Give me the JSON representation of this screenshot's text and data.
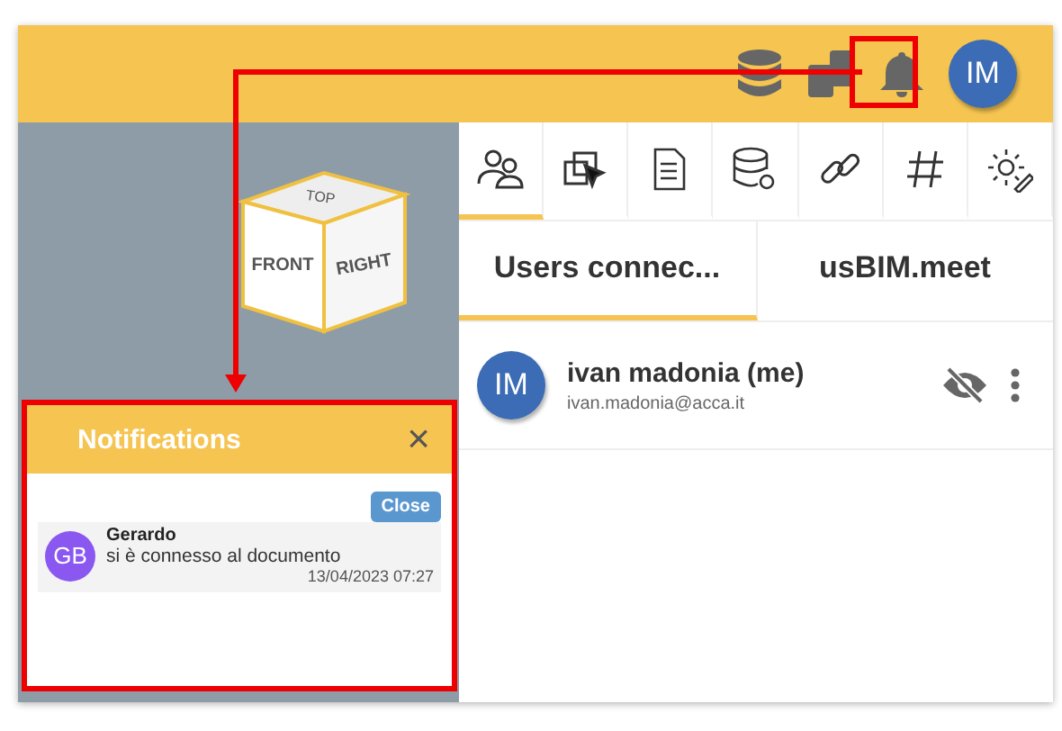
{
  "header": {
    "avatar": "IM"
  },
  "cube": {
    "top": "TOP",
    "front": "FRONT",
    "right": "RIGHT"
  },
  "tool_tabs": [
    {
      "selected": true
    },
    {
      "selected": false
    },
    {
      "selected": false
    },
    {
      "selected": false
    },
    {
      "selected": false
    },
    {
      "selected": false
    },
    {
      "selected": false
    }
  ],
  "panel_tabs": [
    {
      "label": "Users connec...",
      "selected": true
    },
    {
      "label": "usBIM.meet",
      "selected": false
    }
  ],
  "users": [
    {
      "avatar": "IM",
      "name": "ivan madonia (me)",
      "email": "ivan.madonia@acca.it"
    }
  ],
  "notifications": {
    "title": "Notifications",
    "close_icon": "×",
    "close_button": "Close",
    "items": [
      {
        "avatar": "GB",
        "name": "Gerardo",
        "message": "si è connesso al documento",
        "time": "13/04/2023 07:27"
      }
    ]
  }
}
